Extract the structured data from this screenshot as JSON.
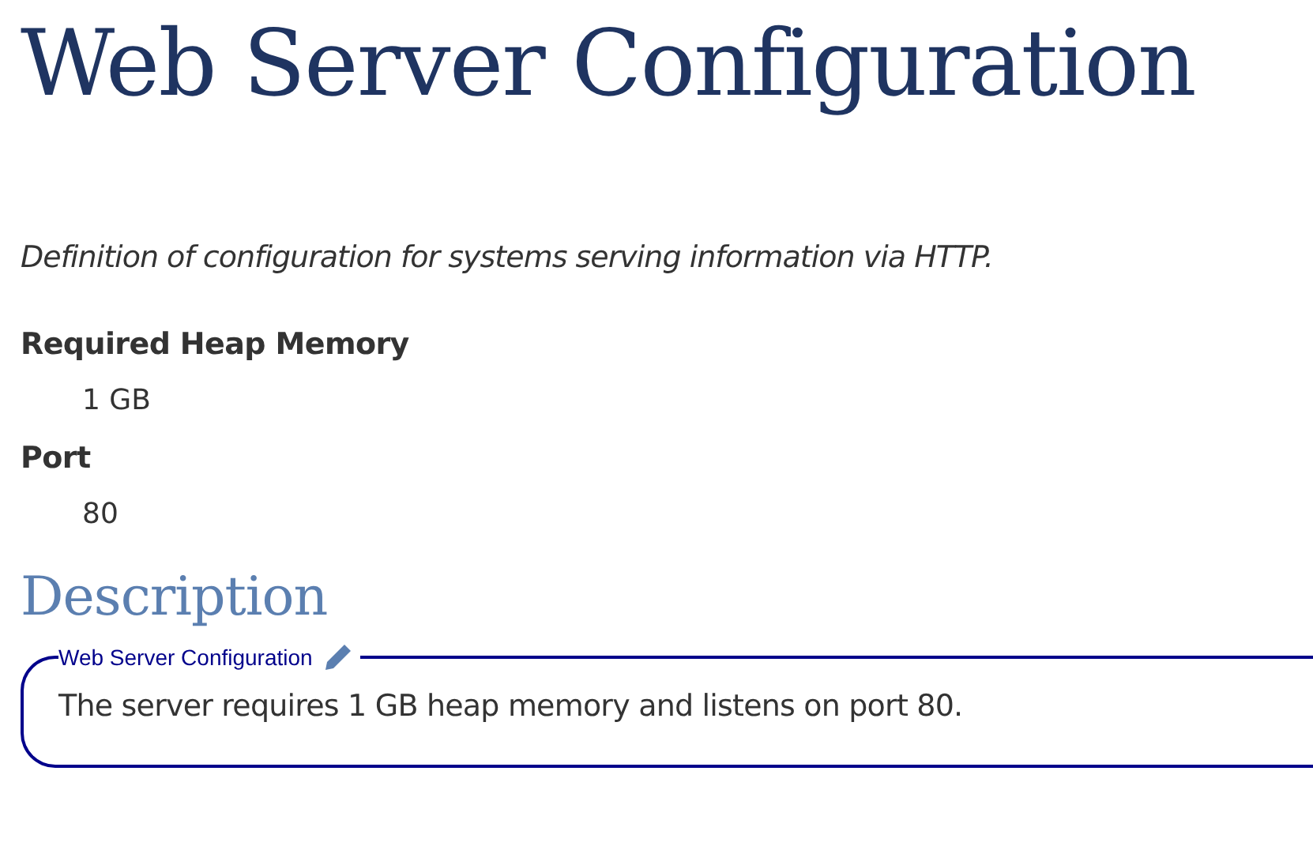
{
  "title": "Web Server Configuration",
  "definition": "Definition of configuration for systems serving information via HTTP.",
  "properties": [
    {
      "name": "Required Heap Memory",
      "value": "1 GB"
    },
    {
      "name": "Port",
      "value": "80"
    }
  ],
  "description": {
    "heading": "Description",
    "legend": "Web Server Configuration",
    "text": "The server requires 1 GB heap memory and listens on port 80."
  }
}
